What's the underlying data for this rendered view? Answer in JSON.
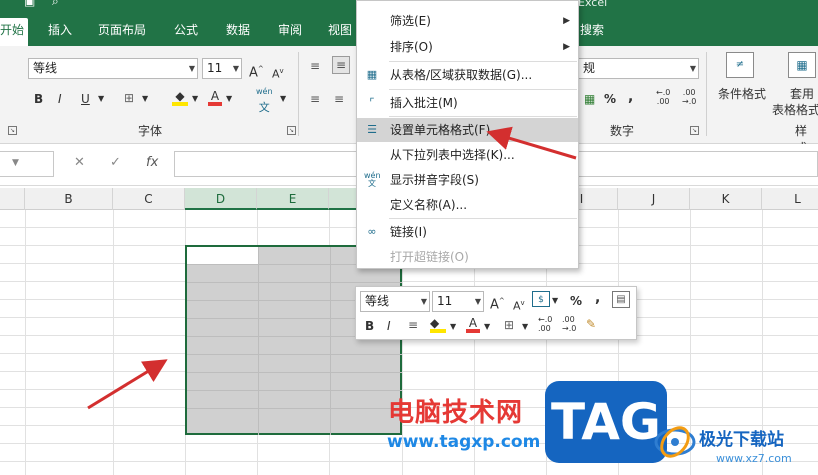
{
  "window": {
    "title_text": "Excel  ",
    "tabs": [
      {
        "label": "开始",
        "active": true
      },
      {
        "label": "插入"
      },
      {
        "label": "页面布局"
      },
      {
        "label": "公式"
      },
      {
        "label": "数据"
      },
      {
        "label": "审阅"
      },
      {
        "label": "视图"
      },
      {
        "label": "搜索"
      }
    ]
  },
  "ribbon": {
    "font_name": "等线",
    "font_size": "11",
    "grow_font": "A",
    "shrink_font": "A",
    "bold": "B",
    "italic": "I",
    "underline": "U",
    "phonetic_top": "wén",
    "phonetic_bottom": "文",
    "font_group_label": "字体",
    "number_format": "规",
    "percent": "%",
    "comma": ",",
    "number_group_label": "数字",
    "conditional_format_label": "条件格式",
    "table_format_label_1": "套用",
    "table_format_label_2": "表格格式",
    "styles_group_label": "样式",
    "accent_color": "#217346"
  },
  "formula_bar": {
    "cancel_symbol": "✕",
    "enter_symbol": "✓",
    "fx_label": "fx",
    "value": ""
  },
  "columns": [
    {
      "label": "",
      "selected": false
    },
    {
      "label": "B",
      "selected": false
    },
    {
      "label": "C",
      "selected": false
    },
    {
      "label": "D",
      "selected": true
    },
    {
      "label": "E",
      "selected": true
    },
    {
      "label": "",
      "selected": true
    },
    {
      "label": "I",
      "selected": false
    },
    {
      "label": "J",
      "selected": false
    },
    {
      "label": "K",
      "selected": false
    },
    {
      "label": "L",
      "selected": false
    }
  ],
  "context_menu": {
    "items": [
      {
        "label": "筛选(E)",
        "submenu": true,
        "icon": "",
        "highlighted": false,
        "disabled": false
      },
      {
        "label": "排序(O)",
        "submenu": true,
        "icon": "",
        "highlighted": false,
        "disabled": false
      },
      {
        "label": "从表格/区域获取数据(G)...",
        "submenu": false,
        "icon": "table-icon",
        "highlighted": false,
        "disabled": false
      },
      {
        "label": "插入批注(M)",
        "submenu": false,
        "icon": "comment-icon",
        "highlighted": false,
        "disabled": false
      },
      {
        "label": "设置单元格格式(F)...",
        "submenu": false,
        "icon": "format-cells-icon",
        "highlighted": true,
        "disabled": false
      },
      {
        "label": "从下拉列表中选择(K)...",
        "submenu": false,
        "icon": "",
        "highlighted": false,
        "disabled": false
      },
      {
        "label": "显示拼音字段(S)",
        "submenu": false,
        "icon": "phonetic-icon",
        "highlighted": false,
        "disabled": false
      },
      {
        "label": "定义名称(A)...",
        "submenu": false,
        "icon": "",
        "highlighted": false,
        "disabled": false
      },
      {
        "label": "链接(I)",
        "submenu": false,
        "icon": "link-icon",
        "highlighted": false,
        "disabled": false
      },
      {
        "label": "打开超链接(O)",
        "submenu": false,
        "icon": "",
        "highlighted": false,
        "disabled": true
      }
    ]
  },
  "mini_toolbar": {
    "font_name": "等线",
    "font_size": "11",
    "grow_font": "A",
    "shrink_font": "A",
    "percent": "%",
    "comma": ",",
    "bold": "B",
    "italic": "I",
    "font_color_letter": "A"
  },
  "watermark": {
    "cn_text": "电脑技术网",
    "url_text": "www.tagxp.com",
    "tag_text": "TAG",
    "site_name": "极光下载站",
    "site_url": "www.xz7.com"
  },
  "annotation_color": "#d32f2f"
}
